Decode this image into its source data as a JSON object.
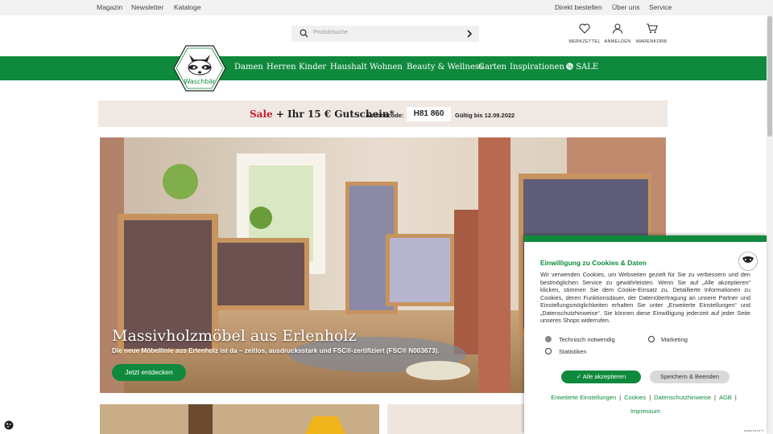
{
  "topbar": {
    "left": [
      "Magazin",
      "Newsletter",
      "Kataloge"
    ],
    "right": [
      "Direkt bestellen",
      "Über uns",
      "Service"
    ]
  },
  "header": {
    "search_placeholder": "Produktsuche",
    "icons": [
      {
        "label": "MERKZETTEL",
        "icon": "heart-icon"
      },
      {
        "label": "ANMELDEN",
        "icon": "user-icon"
      },
      {
        "label": "WARENKORB",
        "icon": "cart-icon"
      }
    ],
    "logo_text": "Waschbär"
  },
  "nav": {
    "items": [
      "Damen",
      "Herren",
      "Kinder",
      "Haushalt",
      "Wohnen",
      "Beauty & Wellness",
      "Garten",
      "Inspirationen",
      "SALE"
    ]
  },
  "promo": {
    "sale": "Sale",
    "text": "+ Ihr 15 € Gutschein*",
    "code_label": "Aktionscode:",
    "code": "H81 860",
    "valid": "Gültig bis 12.09.2022"
  },
  "hero": {
    "title": "Massivholzmöbel aus Erlenholz",
    "subtitle": "Die neue Möbellinie aus Erlenholz ist da – zeitlos, ausdrucksstark und FSC®-zertifiziert (FSC® N003673).",
    "button": "Jetzt entdecken"
  },
  "cookie": {
    "title": "Einwilligung zu Cookies & Daten",
    "text": "Wir verwenden Cookies, um Webseiten gezielt für Sie zu verbessern und den bestmöglichen Service zu gewährleisten. Wenn Sie auf „Alle akzeptieren“ klicken, stimmen Sie dem Cookie-Einsatz zu. Detaillierte Informationen zu Cookies, deren Funktionsdauer, der Datenübertragung an unsere Partner und Einstellungsmöglichkeiten erhalten Sie unter „Erweiterte Einstellungen“ und „Datenschutzhinweise“. Sie können diese Einwilligung jederzeit auf jeder Seite unseres Shops widerrufen.",
    "options": [
      {
        "label": "Technisch notwendig",
        "checked": true
      },
      {
        "label": "Marketing",
        "checked": false
      },
      {
        "label": "Statistiken",
        "checked": false
      }
    ],
    "accept_all": "Alle akzeptieren",
    "save": "Speichern & Beenden",
    "links": [
      "Erweiterte Einstellungen",
      "Cookies",
      "Datenschutzhinweise",
      "AGB",
      "Impressum"
    ],
    "powered": "powered by"
  },
  "colors": {
    "brand_green": "#0f8a3d",
    "sale_red": "#c41d2a"
  }
}
